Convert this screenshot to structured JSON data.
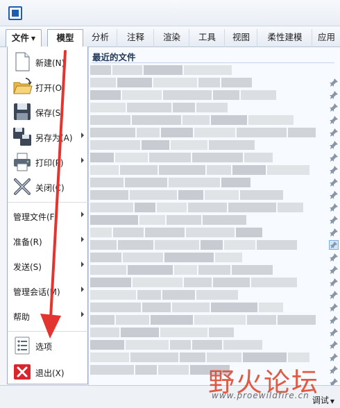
{
  "ribbon": {
    "file_tab": "文件",
    "tabs": [
      "模型",
      "分析",
      "注释",
      "渲染",
      "工具",
      "视图",
      "柔性建模",
      "应用"
    ],
    "active_tab": "模型"
  },
  "file_menu": {
    "items": [
      {
        "label": "新建(N)",
        "icon": "new-document-icon",
        "submenu": false
      },
      {
        "label": "打开(O)",
        "icon": "open-folder-icon",
        "submenu": false
      },
      {
        "label": "保存(S)",
        "icon": "save-disk-icon",
        "submenu": false
      },
      {
        "label": "另存为(A)",
        "icon": "save-as-icon",
        "submenu": true
      },
      {
        "label": "打印(P)",
        "icon": "printer-icon",
        "submenu": true
      },
      {
        "label": "关闭(C)",
        "icon": "close-x-icon",
        "submenu": false
      }
    ],
    "text_items": [
      {
        "label": "管理文件(F)",
        "submenu": true
      },
      {
        "label": "准备(R)",
        "submenu": true
      },
      {
        "label": "发送(S)",
        "submenu": true
      },
      {
        "label": "管理会话(M)",
        "submenu": true
      },
      {
        "label": "帮助",
        "submenu": true
      }
    ],
    "bottom_items": [
      {
        "label": "选项",
        "icon": "options-list-icon"
      },
      {
        "label": "退出(X)",
        "icon": "exit-red-x-icon"
      }
    ]
  },
  "recent_files": {
    "title": "最近的文件"
  },
  "status_bar": {
    "debug_label": "调试"
  },
  "watermark": {
    "text": "野火论坛",
    "url": "www.proewildfire.cn"
  },
  "colors": {
    "accent": "#1b5fb3",
    "annotation_arrow": "#e3342f",
    "exit_red": "#d9252b"
  }
}
